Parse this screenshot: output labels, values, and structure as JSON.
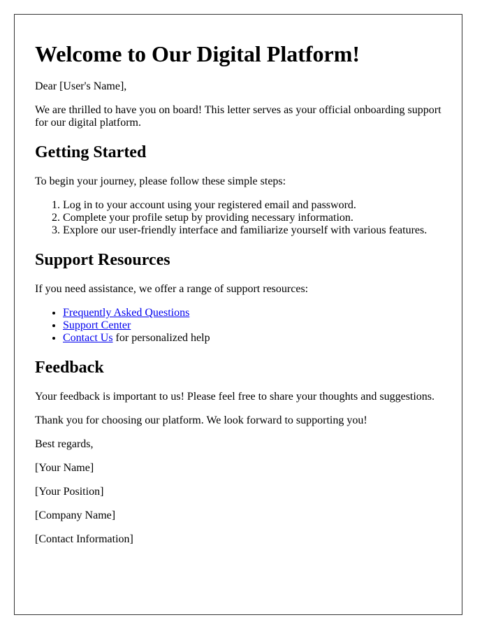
{
  "letter": {
    "title": "Welcome to Our Digital Platform!",
    "greeting": "Dear [User's Name],",
    "intro": "We are thrilled to have you on board! This letter serves as your official onboarding support for our digital platform.",
    "getting_started": {
      "heading": "Getting Started",
      "lead": "To begin your journey, please follow these simple steps:",
      "steps": [
        "Log in to your account using your registered email and password.",
        "Complete your profile setup by providing necessary information.",
        "Explore our user-friendly interface and familiarize yourself with various features."
      ]
    },
    "support": {
      "heading": "Support Resources",
      "lead": "If you need assistance, we offer a range of support resources:",
      "items": [
        {
          "link": "Frequently Asked Questions",
          "suffix": ""
        },
        {
          "link": "Support Center",
          "suffix": ""
        },
        {
          "link": "Contact Us",
          "suffix": " for personalized help"
        }
      ],
      "link_color": "#0000EE"
    },
    "feedback": {
      "heading": "Feedback",
      "text": "Your feedback is important to us! Please feel free to share your thoughts and suggestions."
    },
    "closing": "Thank you for choosing our platform. We look forward to supporting you!",
    "signoff": "Best regards,",
    "signature": {
      "name": "[Your Name]",
      "position": "[Your Position]",
      "company": "[Company Name]",
      "contact": "[Contact Information]"
    }
  }
}
